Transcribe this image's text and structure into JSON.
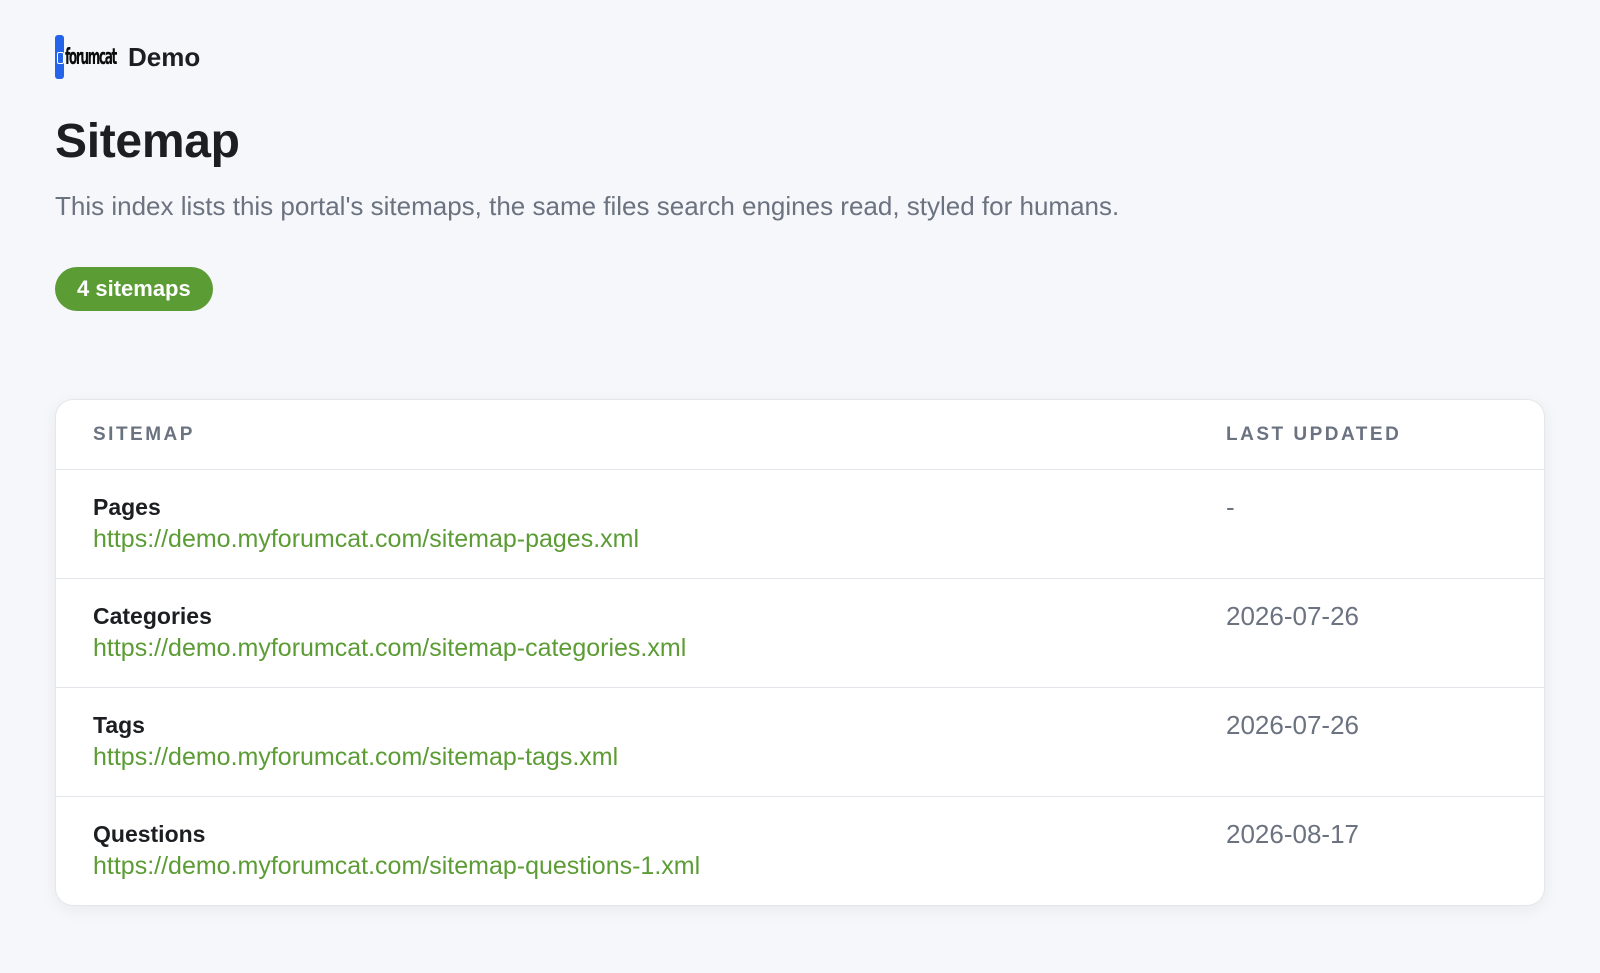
{
  "header": {
    "logo_text": "forumcat",
    "site_name": "Demo"
  },
  "page": {
    "title": "Sitemap",
    "description": "This index lists this portal's sitemaps, the same files search engines read, styled for humans.",
    "badge": "4 sitemaps"
  },
  "table": {
    "columns": [
      "SITEMAP",
      "LAST UPDATED"
    ],
    "rows": [
      {
        "name": "Pages",
        "url": "https://demo.myforumcat.com/sitemap-pages.xml",
        "last_updated": "-"
      },
      {
        "name": "Categories",
        "url": "https://demo.myforumcat.com/sitemap-categories.xml",
        "last_updated": "2026-07-26"
      },
      {
        "name": "Tags",
        "url": "https://demo.myforumcat.com/sitemap-tags.xml",
        "last_updated": "2026-07-26"
      },
      {
        "name": "Questions",
        "url": "https://demo.myforumcat.com/sitemap-questions-1.xml",
        "last_updated": "2026-08-17"
      }
    ]
  },
  "colors": {
    "accent": "#5c9c35",
    "logo_blue": "#2563eb",
    "muted_text": "#6b7280",
    "background": "#f6f7fa"
  },
  "icons": {
    "logo": "forumcat-logo-icon"
  }
}
